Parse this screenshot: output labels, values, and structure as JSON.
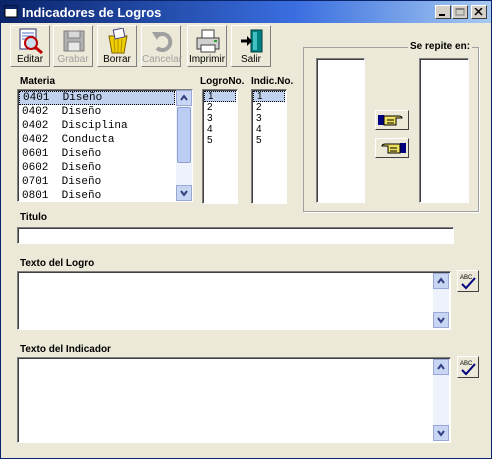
{
  "window": {
    "title": "Indicadores de Logros"
  },
  "toolbar": {
    "editar": "Editar",
    "grabar": "Grabar",
    "borrar": "Borrar",
    "cancelar": "Cancelar",
    "imprimir": "Imprimir",
    "salir": "Salir"
  },
  "labels": {
    "materia": "Materia",
    "logro_no": "LogroNo.",
    "indic_no": "Indic.No.",
    "se_repite": "Se repite en:",
    "titulo": "Titulo",
    "texto_logro": "Texto del Logro",
    "texto_indicador": "Texto del Indicador"
  },
  "materia_list": [
    {
      "code": "0401",
      "name": "Diseño",
      "selected": true
    },
    {
      "code": "0402",
      "name": "Diseño"
    },
    {
      "code": "0402",
      "name": "Disciplina"
    },
    {
      "code": "0402",
      "name": "Conducta"
    },
    {
      "code": "0601",
      "name": "Diseño"
    },
    {
      "code": "0602",
      "name": "Diseño"
    },
    {
      "code": "0701",
      "name": "Diseño"
    },
    {
      "code": "0801",
      "name": "Diseño"
    }
  ],
  "logro_list": [
    "1",
    "2",
    "3",
    "4",
    "5"
  ],
  "indic_list": [
    "1",
    "2",
    "3",
    "4",
    "5"
  ],
  "fields": {
    "titulo": "",
    "texto_logro": "",
    "texto_indicador": ""
  },
  "colors": {
    "titlebar": "#0a246a",
    "selection": "#c1d2ee",
    "background": "#ece9d8"
  }
}
